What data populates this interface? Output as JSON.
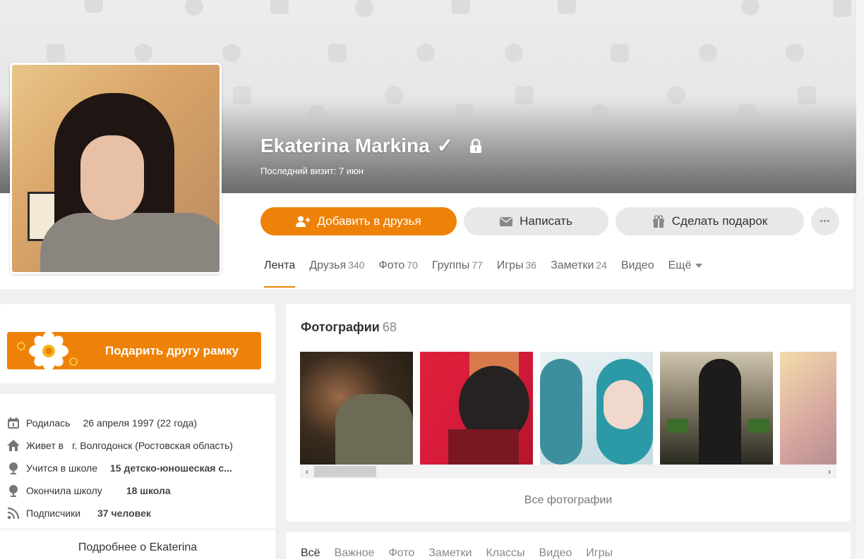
{
  "profile": {
    "name": "Ekaterina Markina",
    "verified_mark": "✓",
    "last_visit": "Последний визит: 7 июн"
  },
  "actions": {
    "add_friend": "Добавить в друзья",
    "message": "Написать",
    "gift": "Сделать подарок",
    "more": "•••"
  },
  "tabs": [
    {
      "label": "Лента",
      "count": ""
    },
    {
      "label": "Друзья",
      "count": "340"
    },
    {
      "label": "Фото",
      "count": "70"
    },
    {
      "label": "Группы",
      "count": "77"
    },
    {
      "label": "Игры",
      "count": "36"
    },
    {
      "label": "Заметки",
      "count": "24"
    },
    {
      "label": "Видео",
      "count": ""
    },
    {
      "label": "Ещё",
      "count": ""
    }
  ],
  "frame_promo": {
    "label": "Подарить другу рамку"
  },
  "info": [
    {
      "icon": "calendar-icon",
      "label": "Родилась",
      "value": "26 апреля 1997 (22 года)"
    },
    {
      "icon": "home-icon",
      "label": "Живет в",
      "value": "г. Волгодонск (Ростовская область)"
    },
    {
      "icon": "school-icon",
      "label": "Учится в школе",
      "value": "15 детско-юношеская с..."
    },
    {
      "icon": "school-icon",
      "label": "Окончила школу",
      "value": "18 школа"
    },
    {
      "icon": "rss-icon",
      "label": "Подписчики",
      "value": "37 человек"
    }
  ],
  "more_about": "Подробнее о Ekaterina",
  "photos": {
    "title": "Фотографии",
    "count": "68",
    "all_link": "Все фотографии",
    "scroll_left": "‹",
    "scroll_right": "›"
  },
  "feed_tabs": [
    "Всё",
    "Важное",
    "Фото",
    "Заметки",
    "Классы",
    "Видео",
    "Игры"
  ],
  "colors": {
    "accent": "#ee8208",
    "background": "#f0f0f0"
  }
}
